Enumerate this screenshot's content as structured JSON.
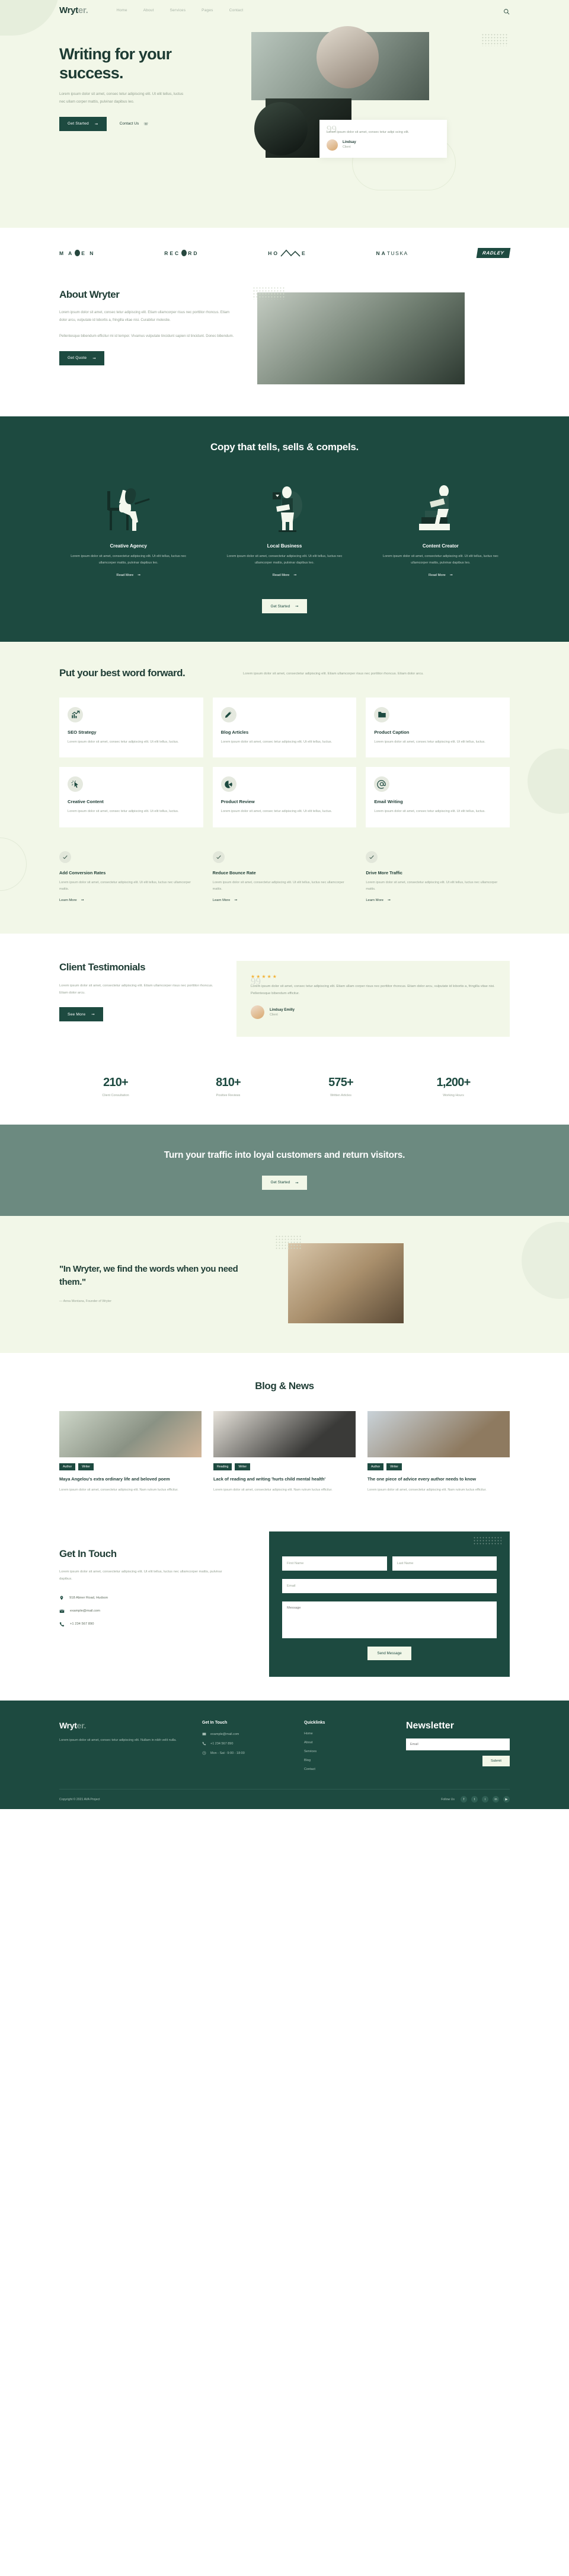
{
  "brand": {
    "name_main": "Wryt",
    "name_dim": "er.",
    "full": "Wryter."
  },
  "colors": {
    "dark_green": "#1d4a40",
    "cream": "#f2f7e8",
    "muted": "#95a192",
    "accent_star": "#f3b236",
    "band": "#6c8a80"
  },
  "nav": {
    "items": [
      {
        "label": "Home"
      },
      {
        "label": "About"
      },
      {
        "label": "Services"
      },
      {
        "label": "Pages"
      },
      {
        "label": "Contact"
      }
    ],
    "search_icon": "search-icon"
  },
  "hero": {
    "title": "Writing for your success.",
    "paragraph": "Lorem ipsum dolor sit amet, consec tetur adipiscing elit. Ut elit tellus, luctus nec ullam corper mattis, pulvinar dapibus leo.",
    "primary_cta": "Get Started",
    "secondary_cta": "Contact Us",
    "quote_card": {
      "quote_mark": "99",
      "text": "Lorem ipsum dolor sit amet, consec tetur adipi scing elit.",
      "name": "Lindsay",
      "role": "Client"
    }
  },
  "brands": [
    {
      "name": "MAVEN"
    },
    {
      "name": "RECORD"
    },
    {
      "name": "HOME"
    },
    {
      "name": "NATUSKA"
    },
    {
      "name": "RADLEY"
    }
  ],
  "about": {
    "title": "About Wryter",
    "p1": "Lorem ipsum dolor sit amet, consec tetur adipiscing elit. Etiam ullamcorper risus nec porttitor rhoncus. Etiam dolor arcu, vulputate id lobortis a, fringilla vitae nisi. Curabitur molestie.",
    "p2": "Pellentesque bibendum efficitur mi id tempor. Vivamus vulputate tincidunt sapien id tincidunt. Donec bibendum.",
    "cta": "Get Quote"
  },
  "dark_section": {
    "title": "Copy that tells, sells & compels.",
    "cards": [
      {
        "title": "Creative Agency",
        "text": "Lorem ipsum dolor sit amet, consectetur adipiscing elit. Ut elit tellus, luctus nec ullamcorper mattis, pulvinar dapibus leo.",
        "link": "Read More"
      },
      {
        "title": "Local Business",
        "text": "Lorem ipsum dolor sit amet, consectetur adipiscing elit. Ut elit tellus, luctus nec ullamcorper mattis, pulvinar dapibus leo.",
        "link": "Read More"
      },
      {
        "title": "Content Creator",
        "text": "Lorem ipsum dolor sit amet, consectetur adipiscing elit. Ut elit tellus, luctus nec ullamcorper mattis, pulvinar dapibus leo.",
        "link": "Read More"
      }
    ],
    "cta": "Get Started"
  },
  "services": {
    "title": "Put your best word forward.",
    "intro": "Lorem ipsum dolor sit amet, consectetur adipiscing elit. Etiam ullamcorper risus nec porttitor rhoncus. Etiam dolor arcu.",
    "cards": [
      {
        "title": "SEO Strategy",
        "icon": "chart-growth-icon",
        "text": "Lorem ipsum dolor sit amet, consec tetur adipiscing elit. Ut elit tellus, luctus."
      },
      {
        "title": "Blog Articles",
        "icon": "pencil-icon",
        "text": "Lorem ipsum dolor sit amet, consec tetur adipiscing elit. Ut elit tellus, luctus."
      },
      {
        "title": "Product Caption",
        "icon": "folder-icon",
        "text": "Lorem ipsum dolor sit amet, consec tetur adipiscing elit. Ut elit tellus, luctus."
      },
      {
        "title": "Creative Content",
        "icon": "cursor-click-icon",
        "text": "Lorem ipsum dolor sit amet, consec tetur adipiscing elit. Ut elit tellus, luctus."
      },
      {
        "title": "Product Review",
        "icon": "pie-chart-icon",
        "text": "Lorem ipsum dolor sit amet, consec tetur adipiscing elit. Ut elit tellus, luctus."
      },
      {
        "title": "Email Writing",
        "icon": "at-sign-icon",
        "text": "Lorem ipsum dolor sit amet, consec tetur adipiscing elit. Ut elit tellus, luctus."
      }
    ],
    "benefits": [
      {
        "title": "Add Conversion Rates",
        "text": "Lorem ipsum dolor sit amet, consectetur adipiscing elit. Ut elit tellus, luctus nec ullamcorper mattis.",
        "link": "Learn More"
      },
      {
        "title": "Reduce Bounce Rate",
        "text": "Lorem ipsum dolor sit amet, consectetur adipiscing elit. Ut elit tellus, luctus nec ullamcorper mattis.",
        "link": "Learn More"
      },
      {
        "title": "Drive More Traffic",
        "text": "Lorem ipsum dolor sit amet, consectetur adipiscing elit. Ut elit tellus, luctus nec ullamcorper mattis.",
        "link": "Learn More"
      }
    ]
  },
  "testimonials": {
    "title": "Client Testimonials",
    "intro": "Lorem ipsum dolor sit amet, consectetur adipiscing elit. Etiam ullamcorper risus nec porttitor rhoncus. Etiam dolor arcu.",
    "cta": "See More",
    "card": {
      "stars": "★★★★★",
      "rating": 5,
      "quote_mark": "99",
      "text": "Lorem ipsum dolor sit amet, consec tetur adipiscing elit. Etiam ullam corper risus nec porttitor rhoncus. Etiam dolor arcu, vulputate id lobortis a, fringilla vitae nisi. Pellentesque bibendum efficitur.",
      "name": "Lindsay Emilly",
      "role": "Client"
    }
  },
  "stats": [
    {
      "value": "210+",
      "label": "Client Consultation"
    },
    {
      "value": "810+",
      "label": "Positive Reviews"
    },
    {
      "value": "575+",
      "label": "Written Articles"
    },
    {
      "value": "1,200+",
      "label": "Working Hours"
    }
  ],
  "band": {
    "title": "Turn your traffic into loyal customers and return visitors.",
    "cta": "Get Started"
  },
  "quote_section": {
    "quote": "\"In Wryter, we find the words when you need them.\"",
    "attribution": "— Anna Montana, Founder of Wryter"
  },
  "blog": {
    "title": "Blog & News",
    "posts": [
      {
        "tags": [
          "Author",
          "Writer"
        ],
        "title": "Maya Angelou's extra ordinary life and beloved poem",
        "excerpt": "Lorem ipsum dolor sit amet, consectetur adipiscing elit. Nam rutrum luctus efficitur."
      },
      {
        "tags": [
          "Reading",
          "Writer"
        ],
        "title": "Lack of reading and writing 'hurts child mental health'",
        "excerpt": "Lorem ipsum dolor sit amet, consectetur adipiscing elit. Nam rutrum luctus efficitur."
      },
      {
        "tags": [
          "Author",
          "Writer"
        ],
        "title": "The one piece of advice every author needs to know",
        "excerpt": "Lorem ipsum dolor sit amet, consectetur adipiscing elit. Nam rutrum luctus efficitur."
      }
    ]
  },
  "contact": {
    "title": "Get In Touch",
    "intro": "Lorem ipsum dolor sit amet, consectetur adipiscing elit. Ut elit tellus, luctus nec ullamcorper mattis, pulvinar dapibus.",
    "address": "918 Abner Road, Hudson",
    "email": "example@mail.com",
    "phone": "+1 234 567 890",
    "form": {
      "first_name_placeholder": "First Name",
      "last_name_placeholder": "Last Name",
      "email_placeholder": "Email",
      "message_placeholder": "Message",
      "submit": "Send Message"
    }
  },
  "footer": {
    "about": "Lorem ipsum dolor sit amet, consec tetur adipiscing elit. Nullam in nibh velit nulla.",
    "contact_heading": "Get In Touch",
    "contact_items": [
      {
        "label": "example@mail.com",
        "icon": "mail-icon"
      },
      {
        "label": "+1 234 567 890",
        "icon": "phone-icon"
      },
      {
        "label": "Mon - Sat : 9:00 - 18:00",
        "icon": "clock-icon"
      }
    ],
    "quicklinks_heading": "Quicklinks",
    "quicklinks": [
      {
        "label": "Home"
      },
      {
        "label": "About"
      },
      {
        "label": "Services"
      },
      {
        "label": "Blog"
      },
      {
        "label": "Contact"
      }
    ],
    "newsletter_heading": "Newsletter",
    "newsletter_placeholder": "Email",
    "newsletter_submit": "Submit",
    "copyright": "Copyright © 2021 AVA Project",
    "follow_label": "Follow Us",
    "social": [
      {
        "name": "facebook-icon",
        "glyph": "f"
      },
      {
        "name": "twitter-icon",
        "glyph": "t"
      },
      {
        "name": "instagram-icon",
        "glyph": "i"
      },
      {
        "name": "linkedin-icon",
        "glyph": "in"
      },
      {
        "name": "youtube-icon",
        "glyph": "▶"
      }
    ]
  }
}
